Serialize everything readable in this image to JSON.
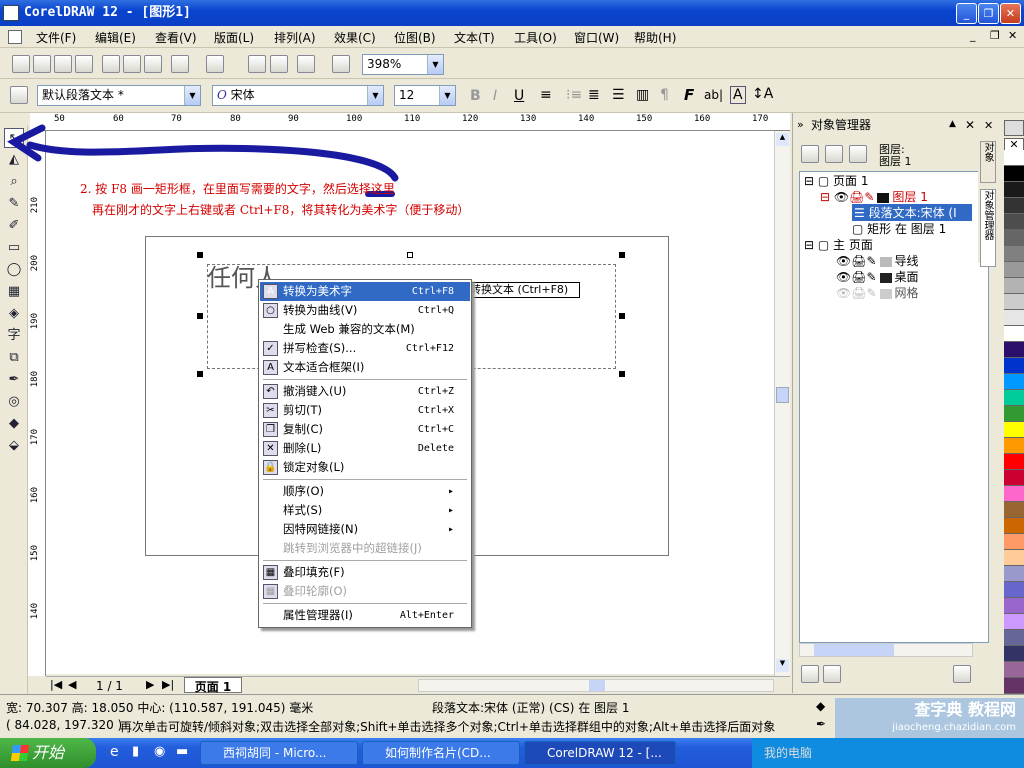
{
  "title": "CorelDRAW 12 - [图形1]",
  "menu": [
    "文件(F)",
    "编辑(E)",
    "查看(V)",
    "版面(L)",
    "排列(A)",
    "效果(C)",
    "位图(B)",
    "文本(T)",
    "工具(O)",
    "窗口(W)",
    "帮助(H)"
  ],
  "zoom": "398%",
  "style": "默认段落文本 *",
  "font": "宋体",
  "size": "12",
  "hruler": [
    "50",
    "60",
    "70",
    "80",
    "90",
    "100",
    "110",
    "120",
    "130",
    "140",
    "150",
    "160",
    "170"
  ],
  "vruler": [
    "210",
    "200",
    "190",
    "180",
    "170",
    "160",
    "150",
    "140"
  ],
  "annotation": {
    "line1": "2. 按 F8 画一矩形框，在里面写需要的文字，然后选择这里",
    "line2": "再在刚才的文字上右键或者 Ctrl+F8，将其转化为美术字（便于移动）"
  },
  "canvas_text": "任何人",
  "tooltip": "转换文本 (Ctrl+F8)",
  "context_menu": [
    {
      "label": "转换为美术字",
      "shortcut": "Ctrl+F8",
      "icon": "A"
    },
    {
      "label": "转换为曲线(V)",
      "shortcut": "Ctrl+Q",
      "icon": "○"
    },
    {
      "label": "生成 Web 兼容的文本(M)",
      "shortcut": "",
      "icon": ""
    },
    {
      "label": "拼写检查(S)...",
      "shortcut": "Ctrl+F12",
      "icon": "✓"
    },
    {
      "label": "文本适合框架(I)",
      "shortcut": "",
      "icon": "A"
    },
    {
      "label": "撤消键入(U)",
      "shortcut": "Ctrl+Z",
      "icon": "↶"
    },
    {
      "label": "剪切(T)",
      "shortcut": "Ctrl+X",
      "icon": "✂"
    },
    {
      "label": "复制(C)",
      "shortcut": "Ctrl+C",
      "icon": "❐"
    },
    {
      "label": "删除(L)",
      "shortcut": "Delete",
      "icon": "✕"
    },
    {
      "label": "锁定对象(L)",
      "shortcut": "",
      "icon": "🔒"
    },
    {
      "label": "顺序(O)",
      "shortcut": "",
      "icon": ""
    },
    {
      "label": "样式(S)",
      "shortcut": "",
      "icon": ""
    },
    {
      "label": "因特网链接(N)",
      "shortcut": "",
      "icon": ""
    },
    {
      "label": "跳转到浏览器中的超链接(J)",
      "shortcut": "",
      "icon": ""
    },
    {
      "label": "叠印填充(F)",
      "shortcut": "",
      "icon": "▦"
    },
    {
      "label": "叠印轮廓(O)",
      "shortcut": "",
      "icon": "▦"
    },
    {
      "label": "属性管理器(I)",
      "shortcut": "Alt+Enter",
      "icon": ""
    }
  ],
  "page_tabs": {
    "nav": "1 / 1",
    "tab": "页面 1"
  },
  "objmgr": {
    "title": "对象管理器",
    "layer_hdr": "图层:",
    "layer_name": "图层 1",
    "tree": [
      "页面 1",
      "图层 1",
      "段落文本:宋体 (I",
      "矩形 在 图层 1",
      "主 页面",
      "导线",
      "桌面",
      "网格"
    ]
  },
  "dock_tabs": [
    "对象",
    "对象管理器"
  ],
  "status": {
    "left1": "宽: 70.307 高: 18.050 中心: (110.587, 191.045) 毫米",
    "mid1": "段落文本:宋体 (正常) (CS) 在 图层 1",
    "left2": "( 84.028, 197.320 )",
    "mid2": "再次单击可旋转/倾斜对象;双击选择全部对象;Shift+单击选择多个对象;Ctrl+单击选择群组中的对象;Alt+单击选择后面对象"
  },
  "taskbar": {
    "start": "开始",
    "tasks": [
      "西祠胡同 - Micro...",
      "如何制作名片(CD...",
      "CorelDRAW 12 - [..."
    ],
    "tray": "我的电脑"
  },
  "watermark": {
    "line1": "查字典 教程网",
    "line2": "jiaocheng.chazidian.com"
  },
  "palette": [
    "#ffffff",
    "#000000",
    "#1a1a1a",
    "#333333",
    "#4d4d4d",
    "#666666",
    "#808080",
    "#999999",
    "#b3b3b3",
    "#cccccc",
    "#e6e6e6",
    "#ffffff",
    "#2b0f6b",
    "#0033cc",
    "#0099ff",
    "#00cc99",
    "#339933",
    "#ffff00",
    "#ff9900",
    "#ff0000",
    "#cc0033",
    "#ff66cc",
    "#996633",
    "#cc6600",
    "#ff9966",
    "#ffcc99",
    "#9999cc",
    "#6666cc",
    "#9966cc",
    "#cc99ff",
    "#666699",
    "#333366",
    "#996699",
    "#663366"
  ]
}
